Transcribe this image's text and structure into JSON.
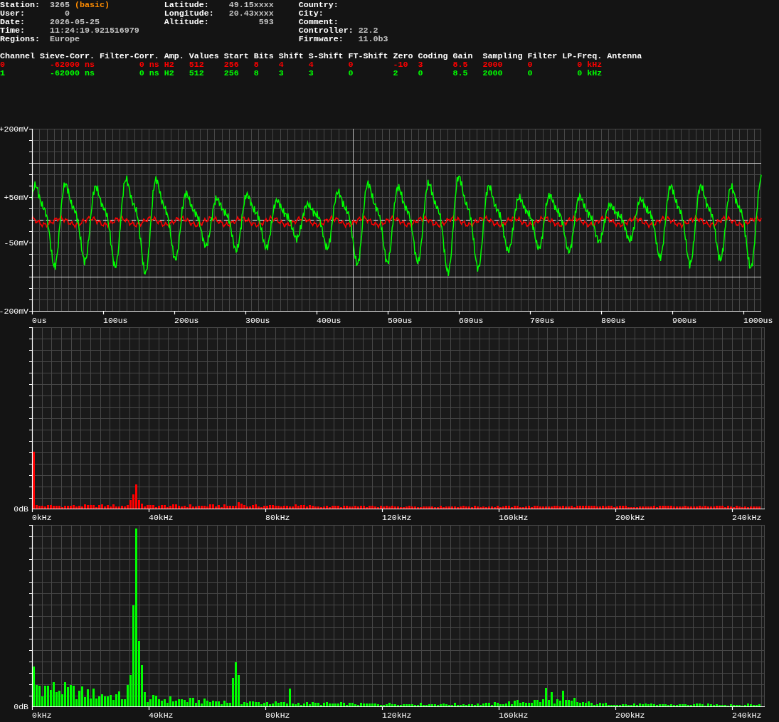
{
  "info_columns": [
    [
      {
        "label": "Station:",
        "value": "3265",
        "tag": "(basic)"
      },
      {
        "label": "User:",
        "value": "0"
      },
      {
        "label": "Date:",
        "value": "2026-05-25"
      },
      {
        "label": "Time:",
        "value": "11:24:19.921516979"
      },
      {
        "label": "Regions:",
        "value": "Europe"
      }
    ],
    [
      {
        "label": "Latitude:",
        "value": "49.15xxxx"
      },
      {
        "label": "Longitude:",
        "value": "20.43xxxx"
      },
      {
        "label": "Altitude:",
        "value": "593"
      }
    ],
    [
      {
        "label": "Country:"
      },
      {
        "label": "City:"
      },
      {
        "label": "Comment:"
      },
      {
        "label": "Controller:",
        "value": "22.2"
      },
      {
        "label": "Firmware:",
        "value": "11.0b3"
      }
    ]
  ],
  "channel_table": {
    "columns": [
      "Channel",
      "Sieve-Corr.",
      "Filter-Corr.",
      "Amp.",
      "Values",
      "Start",
      "Bits",
      "Shift",
      "S-Shift",
      "FT-Shift",
      "Zero",
      "Coding",
      "Gain",
      "Sampling",
      "Filter",
      "LP-Freq.",
      "Antenna"
    ],
    "rows": [
      {
        "color": "#ff0000",
        "cells": [
          "0",
          "-62000 ns",
          "0 ns",
          "H2",
          "512",
          "256",
          "8",
          "4",
          "4",
          "0",
          "-10",
          "3",
          "8.5",
          "2000",
          "0",
          "0 kHz"
        ]
      },
      {
        "color": "#00ff00",
        "cells": [
          "1",
          "-62000 ns",
          "0 ns",
          "H2",
          "512",
          "256",
          "8",
          "3",
          "3",
          "0",
          "2",
          "0",
          "8.5",
          "2000",
          "0",
          "0 kHz"
        ]
      }
    ]
  },
  "charts": [
    {
      "kind": "waveform",
      "y_labels": [
        "+200mV",
        "+50mV",
        "-50mV",
        "-200mV"
      ],
      "x_labels": [
        "0us",
        "100us",
        "200us",
        "300us",
        "400us",
        "500us",
        "600us",
        "700us",
        "800us",
        "900us",
        "1000us"
      ]
    },
    {
      "kind": "spectrum",
      "y_labels": [
        "0dB"
      ],
      "x_labels": [
        "0kHz",
        "40kHz",
        "80kHz",
        "120kHz",
        "160kHz",
        "200kHz",
        "240kHz"
      ]
    },
    {
      "kind": "spectrum",
      "y_labels": [
        "0dB"
      ],
      "x_labels": [
        "0kHz",
        "40kHz",
        "80kHz",
        "120kHz",
        "160kHz",
        "200kHz",
        "240kHz"
      ]
    }
  ]
}
